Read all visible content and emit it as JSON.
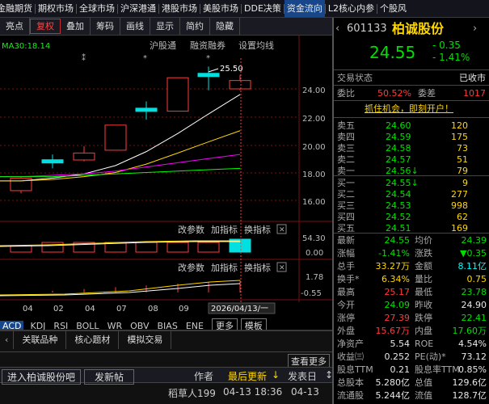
{
  "nav": {
    "items": [
      "金融期货",
      "期权市场",
      "全球市场",
      "沪深港通",
      "港股市场",
      "美股市场",
      "DDE决策",
      "资金流向",
      "L2核心内参",
      "个股风"
    ]
  },
  "toolbar": {
    "items": [
      "亮点",
      "复权",
      "叠加",
      "筹码",
      "画线",
      "显示",
      "简约",
      "隐藏"
    ],
    "active_index": 1
  },
  "chart": {
    "ma_label": "MA30:18.14",
    "float_tabs": [
      "沪股通",
      "融资融券",
      "设置均线"
    ],
    "max_label": "25.50",
    "price_ticks": [
      "24.00",
      "22.00",
      "20.00",
      "18.00",
      "16.00"
    ],
    "vol_panel": {
      "buttons": [
        "改参数",
        "加指标",
        "换指标"
      ],
      "ticks": [
        "54.30",
        "0.00"
      ]
    },
    "ind_panel": {
      "buttons": [
        "改参数",
        "加指标",
        "换指标"
      ],
      "ticks": [
        "1.78",
        "-0.55"
      ]
    },
    "dates": [
      "04",
      "02",
      "04",
      "07",
      "08",
      "09"
    ],
    "cursor_date": "2026/04/13/一",
    "candles": [
      {
        "o": 16.7,
        "c": 17.6,
        "h": 17.7,
        "l": 16.5
      },
      {
        "o": 18.8,
        "c": 18.8,
        "h": 19.3,
        "l": 18.3
      },
      {
        "o": 18.9,
        "c": 19.4,
        "h": 19.9,
        "l": 18.8
      },
      {
        "o": 19.6,
        "c": 21.4,
        "h": 21.4,
        "l": 19.6
      },
      {
        "o": 22.5,
        "c": 22.5,
        "h": 23.1,
        "l": 21.8
      },
      {
        "o": 22.4,
        "c": 24.8,
        "h": 24.8,
        "l": 22.4
      },
      {
        "o": 25.0,
        "c": 25.0,
        "h": 25.6,
        "l": 23.9
      },
      {
        "o": 24.0,
        "c": 24.6,
        "h": 25.0,
        "l": 23.9
      }
    ],
    "ma_series": [
      [
        17.4,
        17.6,
        17.9,
        18.5,
        19.5,
        20.8,
        22.2,
        23.6
      ],
      [
        17.4,
        17.5,
        17.7,
        18.0,
        18.6,
        19.4,
        20.2,
        21.0
      ],
      [
        17.7,
        17.8,
        17.9,
        18.1,
        18.4,
        18.7,
        19.0,
        19.3
      ],
      [
        17.7,
        17.7,
        17.8,
        17.9,
        18.0,
        18.1,
        18.2,
        18.3
      ]
    ],
    "colors": {
      "up": "#ff3b3b",
      "flat": "#00e0e0",
      "ma": [
        "#ffffff",
        "#ffd700",
        "#ff00ff",
        "#00ff00"
      ]
    }
  },
  "indicators": {
    "items": [
      "ACD",
      "KDJ",
      "RSI",
      "BOLL",
      "WR",
      "OBV",
      "BIAS",
      "ENE",
      "更多",
      "模板"
    ]
  },
  "related": {
    "tabs": [
      "关联品种",
      "核心题材",
      "模拟交易"
    ],
    "more": "查看更多",
    "bar": [
      "进入柏诚股份吧",
      "发新帖",
      "作者",
      "最后更新",
      "发表日"
    ],
    "post": {
      "author": "稻草人199",
      "date1": "04-13 18:36",
      "date2": "04-13"
    }
  },
  "stock": {
    "code": "601133",
    "name": "柏诚股份",
    "price": "24.55",
    "change": "- 0.35",
    "pct": "- 1.41%",
    "status_label": "交易状态",
    "status": "已收市",
    "weibi_label": "委比",
    "weibi": "50.52%",
    "weicha_label": "委差",
    "weicha": "1017",
    "ad": "抓住机会，即刻开户！",
    "sell": [
      {
        "l": "卖五",
        "p": "24.60",
        "v": "120"
      },
      {
        "l": "卖四",
        "p": "24.59",
        "v": "175"
      },
      {
        "l": "卖三",
        "p": "24.58",
        "v": "73"
      },
      {
        "l": "卖二",
        "p": "24.57",
        "v": "51"
      },
      {
        "l": "卖一",
        "p": "24.56↓",
        "v": "79"
      }
    ],
    "buy": [
      {
        "l": "买一",
        "p": "24.55↓",
        "v": "9"
      },
      {
        "l": "买二",
        "p": "24.54",
        "v": "277"
      },
      {
        "l": "买三",
        "p": "24.53",
        "v": "998"
      },
      {
        "l": "买四",
        "p": "24.52",
        "v": "62"
      },
      {
        "l": "买五",
        "p": "24.51",
        "v": "169"
      }
    ],
    "stats": [
      {
        "l1": "最新",
        "v1": "24.55",
        "c1": "grn",
        "l2": "均价",
        "v2": "24.39",
        "c2": "grn"
      },
      {
        "l1": "涨幅",
        "v1": "-1.41%",
        "c1": "grn",
        "l2": "涨跌",
        "v2": "▼0.35",
        "c2": "grn"
      },
      {
        "l1": "总手",
        "v1": "33.27万",
        "c1": "yel",
        "l2": "金额",
        "v2": "8.11亿",
        "c2": "cyan"
      },
      {
        "l1": "换手*",
        "v1": "6.34%",
        "c1": "yel",
        "l2": "量比",
        "v2": "0.75",
        "c2": "yel"
      },
      {
        "l1": "最高",
        "v1": "25.17",
        "c1": "red",
        "l2": "最低",
        "v2": "23.78",
        "c2": "grn"
      },
      {
        "l1": "今开",
        "v1": "24.09",
        "c1": "grn",
        "l2": "昨收",
        "v2": "24.90",
        "c2": "wht"
      },
      {
        "l1": "涨停",
        "v1": "27.39",
        "c1": "red",
        "l2": "跌停",
        "v2": "22.41",
        "c2": "grn"
      },
      {
        "l1": "外盘",
        "v1": "15.67万",
        "c1": "red",
        "l2": "内盘",
        "v2": "17.60万",
        "c2": "grn"
      },
      {
        "l1": "净资产",
        "v1": "5.54",
        "c1": "wht",
        "l2": "ROE",
        "v2": "4.54%",
        "c2": "wht"
      },
      {
        "l1": "收益㈢",
        "v1": "0.252",
        "c1": "wht",
        "l2": "PE(动)*",
        "v2": "73.12",
        "c2": "wht"
      },
      {
        "l1": "股息TTM",
        "v1": "0.21",
        "c1": "wht",
        "l2": "股息率TTM",
        "v2": "0.85%",
        "c2": "wht"
      },
      {
        "l1": "总股本",
        "v1": "5.280亿",
        "c1": "wht",
        "l2": "总值",
        "v2": "129.6亿",
        "c2": "wht"
      },
      {
        "l1": "流通股",
        "v1": "5.244亿",
        "c1": "wht",
        "l2": "流值",
        "v2": "128.7亿",
        "c2": "wht"
      }
    ]
  }
}
